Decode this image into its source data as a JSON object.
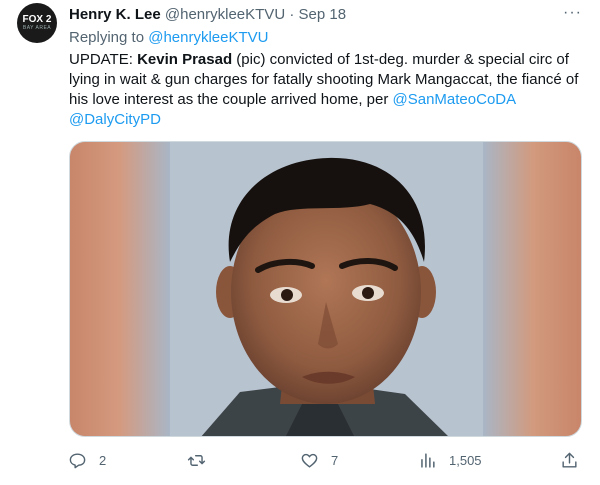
{
  "tweet": {
    "display_name": "Henry K. Lee",
    "handle": "@henrykleeKTVU",
    "separator": "·",
    "date": "Sep 18",
    "more_label": "···",
    "avatar_text": "FOX 2",
    "avatar_subtext": "BAY AREA",
    "reply": {
      "prefix": "Replying to",
      "handle": "@henrykleeKTVU"
    },
    "text": {
      "part1": "UPDATE: ",
      "bold_name": "Kevin Prasad",
      "part2": " (pic) convicted of 1st-deg. murder & special circ of lying in wait & gun charges for fatally shooting Mark Mangaccat, the fiancé of his love interest as the couple arrived home, per ",
      "mention1": "@SanMateoCoDA",
      "mention2": "@DalyCityPD"
    },
    "actions": {
      "replies": "2",
      "retweets": "",
      "likes": "7",
      "views": "1,505"
    }
  },
  "colors": {
    "link": "#1d9bf0",
    "secondary_text": "#536471",
    "primary_text": "#0f1419"
  },
  "icons": [
    "more-icon",
    "reply-icon",
    "retweet-icon",
    "like-icon",
    "views-icon",
    "share-icon"
  ]
}
